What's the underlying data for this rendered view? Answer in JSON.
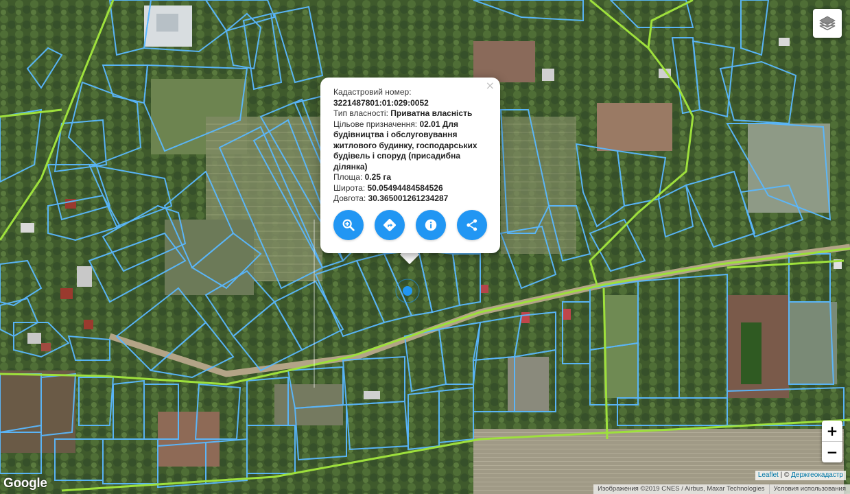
{
  "popup": {
    "close_glyph": "×",
    "cadastral_label": "Кадастровий номер:",
    "cadastral_number": "3221487801:01:029:0052",
    "ownership_label": "Тип власності:",
    "ownership_value": "Приватна власність",
    "purpose_label": "Цільове призначення:",
    "purpose_value": "02.01 Для будівництва і обслуговування житлового будинку, господарських будівель і споруд (присадибна ділянка)",
    "area_label": "Площа:",
    "area_value": "0.25 га",
    "lat_label": "Широта:",
    "lat_value": "50.05494484584526",
    "lon_label": "Довгота:",
    "lon_value": "30.365001261234287",
    "actions": [
      {
        "icon": "zoom-in-icon"
      },
      {
        "icon": "directions-icon"
      },
      {
        "icon": "info-icon"
      },
      {
        "icon": "share-icon"
      }
    ]
  },
  "controls": {
    "zoom_in": "+",
    "zoom_out": "−",
    "layers_icon": "layers-icon"
  },
  "attribution": {
    "leaflet": "Leaflet",
    "separator": "| ©",
    "provider": "Держгеокадастр"
  },
  "google_bar": {
    "imagery": "Изображения ©2019 CNES / Airbus, Maxar Technologies",
    "terms": "Условия использования"
  },
  "google_logo": "Google",
  "colors": {
    "parcel_outline": "#5ab8ff",
    "road_line": "#9ee03c",
    "marker": "#2196f3",
    "action_button": "#2196f3"
  }
}
